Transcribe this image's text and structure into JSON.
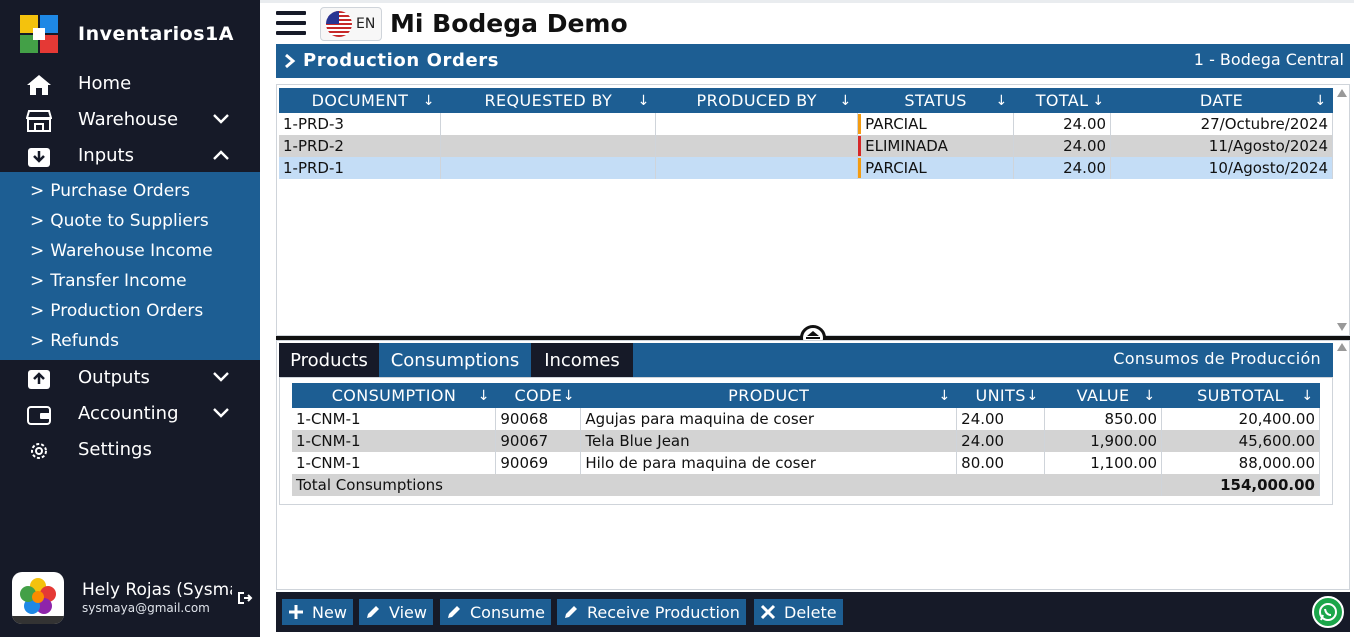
{
  "app": {
    "brand": "Inventarios1A",
    "title": "Mi Bodega Demo",
    "lang_code": "EN"
  },
  "sidebar": {
    "items": [
      {
        "label": "Home",
        "icon": "home-icon"
      },
      {
        "label": "Warehouse",
        "icon": "store-icon"
      },
      {
        "label": "Inputs",
        "icon": "inbox-download-icon"
      },
      {
        "label": "Outputs",
        "icon": "inbox-upload-icon"
      },
      {
        "label": "Accounting",
        "icon": "wallet-icon"
      },
      {
        "label": "Settings",
        "icon": "gear-icon"
      }
    ],
    "inputs_submenu": [
      "Purchase Orders",
      "Quote to Suppliers",
      "Warehouse Income",
      "Transfer Income",
      "Production Orders",
      "Refunds"
    ],
    "user": {
      "name": "Hely Rojas (Sysmaya)",
      "email": "sysmaya@gmail.com",
      "avatar_text": "sysmaya"
    }
  },
  "section": {
    "title": "Production Orders",
    "warehouse": "1 - Bodega Central"
  },
  "orders": {
    "columns": [
      "DOCUMENT",
      "REQUESTED BY",
      "PRODUCED BY",
      "STATUS",
      "TOTAL",
      "DATE"
    ],
    "rows": [
      {
        "document": "1-PRD-3",
        "requested_by": "",
        "produced_by": "",
        "status": "PARCIAL",
        "status_color": "#f39c12",
        "total": "24.00",
        "date": "27/Octubre/2024"
      },
      {
        "document": "1-PRD-2",
        "requested_by": "",
        "produced_by": "",
        "status": "ELIMINADA",
        "status_color": "#d62828",
        "total": "24.00",
        "date": "11/Agosto/2024"
      },
      {
        "document": "1-PRD-1",
        "requested_by": "",
        "produced_by": "",
        "status": "PARCIAL",
        "status_color": "#f39c12",
        "total": "24.00",
        "date": "10/Agosto/2024"
      }
    ]
  },
  "detail": {
    "tabs": [
      "Products",
      "Consumptions",
      "Incomes"
    ],
    "active_tab": "Consumptions",
    "heading": "Consumos de Producción",
    "columns": [
      "CONSUMPTION",
      "CODE",
      "PRODUCT",
      "UNITS",
      "VALUE",
      "SUBTOTAL"
    ],
    "rows": [
      {
        "consumption": "1-CNM-1",
        "code": "90068",
        "product": "Agujas para maquina de coser",
        "units": "24.00",
        "value": "850.00",
        "subtotal": "20,400.00"
      },
      {
        "consumption": "1-CNM-1",
        "code": "90067",
        "product": "Tela Blue Jean",
        "units": "24.00",
        "value": "1,900.00",
        "subtotal": "45,600.00"
      },
      {
        "consumption": "1-CNM-1",
        "code": "90069",
        "product": "Hilo de para maquina de coser",
        "units": "80.00",
        "value": "1,100.00",
        "subtotal": "88,000.00"
      }
    ],
    "total_label": "Total Consumptions",
    "total_value": "154,000.00"
  },
  "toolbar": {
    "new": "New",
    "view": "View",
    "consume": "Consume",
    "receive": "Receive Production",
    "delete": "Delete"
  },
  "sort_arrow": "↓",
  "colors": {
    "primary": "#1d5e93",
    "dark": "#161a28",
    "row_selected": "#c4ddf6",
    "row_alt": "#d3d3d3",
    "whatsapp": "#1ba64a"
  }
}
